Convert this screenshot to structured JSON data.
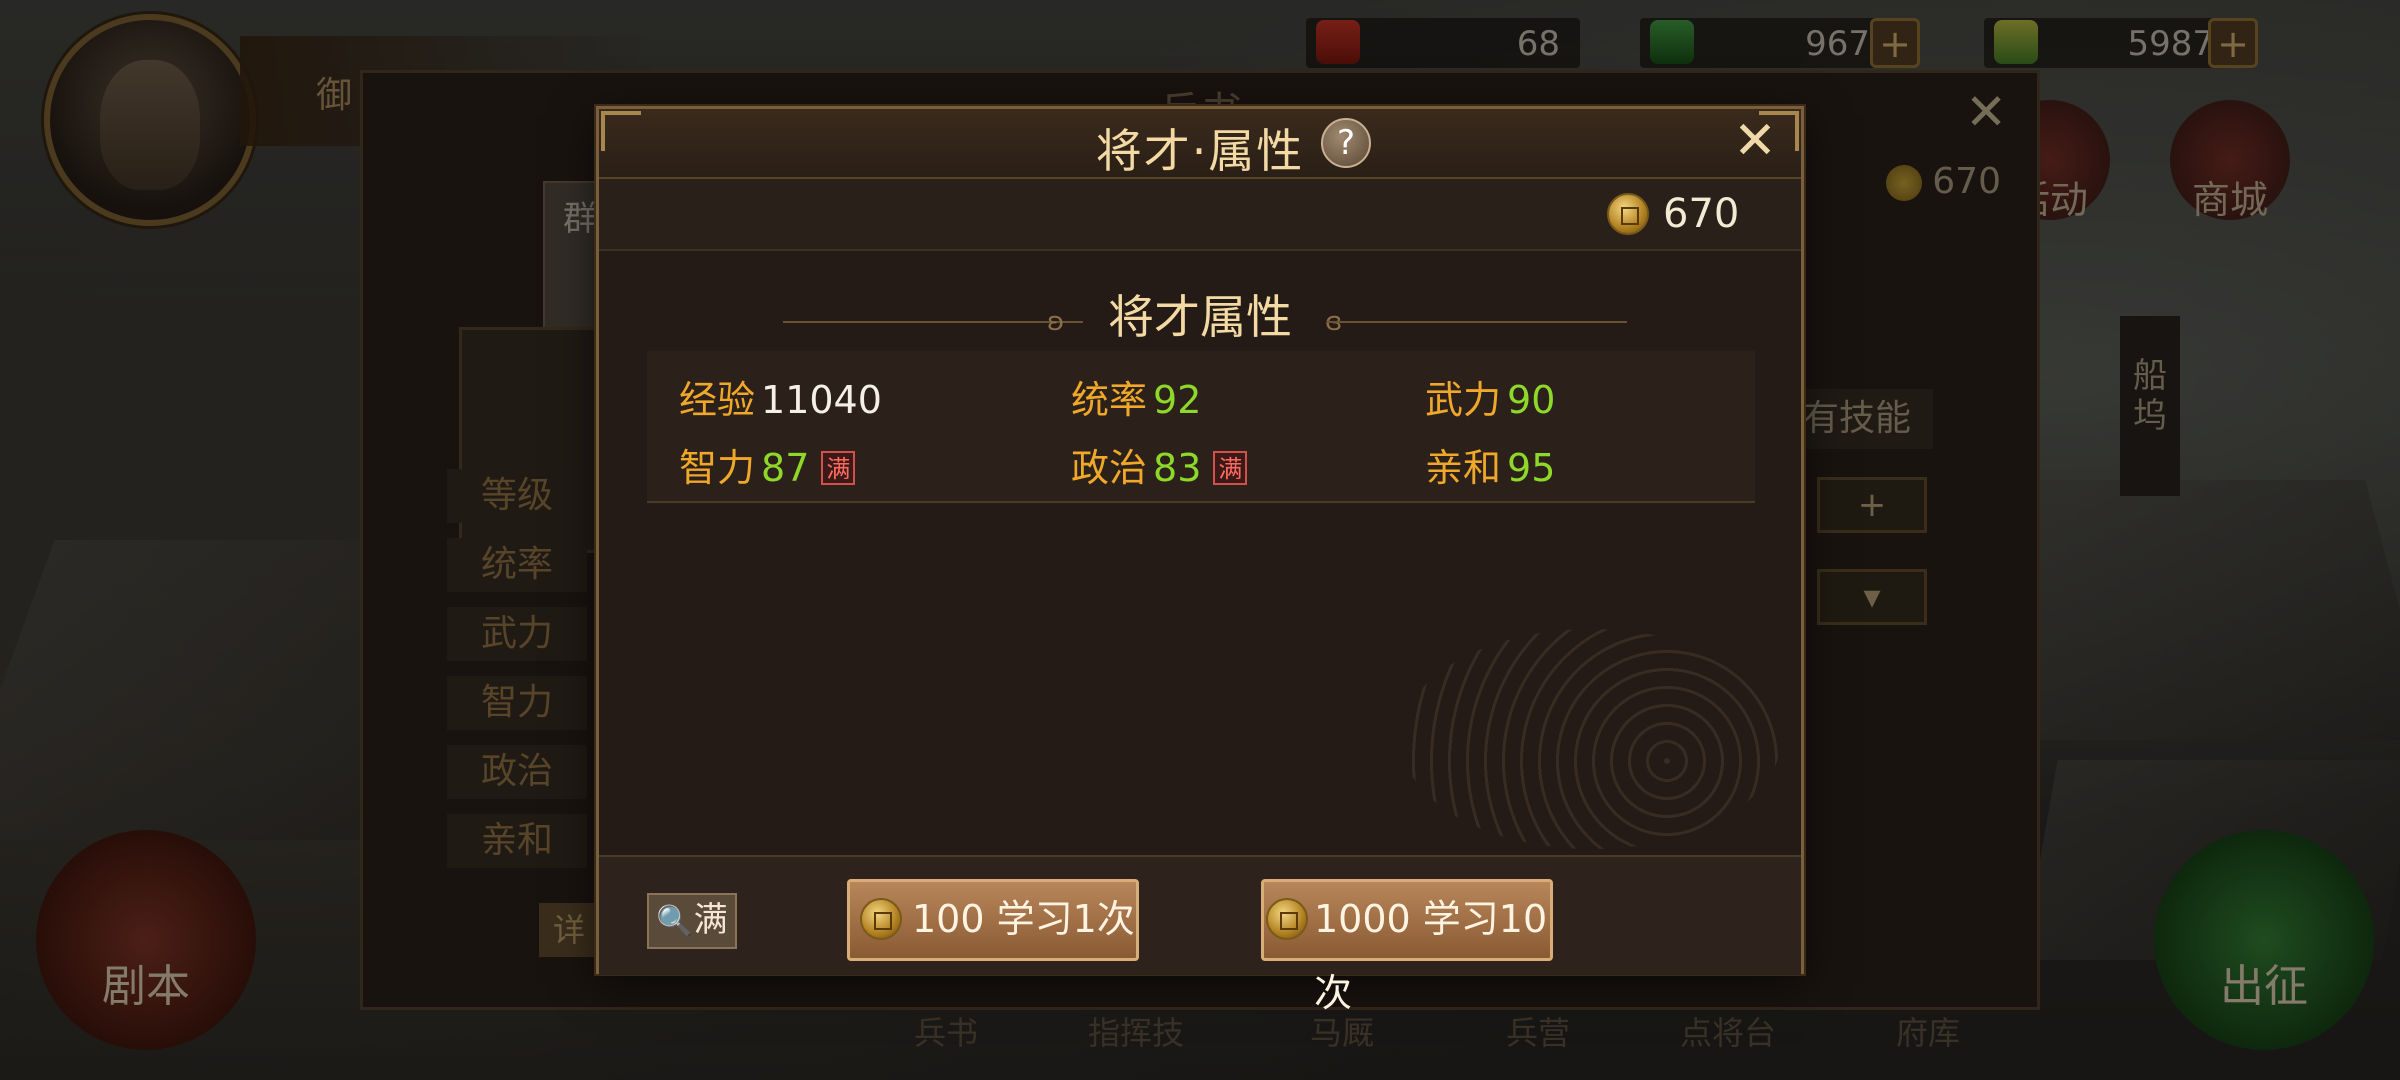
{
  "hud": {
    "player_name": "御",
    "resources": [
      {
        "icon": "red-token-icon",
        "value": "68"
      },
      {
        "icon": "jade-icon",
        "value": "967"
      },
      {
        "icon": "jade-ticket-icon",
        "value": "5987"
      }
    ],
    "top_buttons": [
      {
        "icon": "activity-icon",
        "label": "活动"
      },
      {
        "icon": "shop-icon",
        "label": "商城"
      }
    ],
    "side_tag": "船坞",
    "left_round_button": "剧本",
    "right_round_button": "出征"
  },
  "back_panel": {
    "title": "兵书",
    "faction_flag": "群",
    "coin_value": "670",
    "skill_label": "有技能",
    "attr_labels": [
      "等级",
      "统率",
      "武力",
      "智力",
      "政治",
      "亲和"
    ],
    "detail_label": "详",
    "tabs": [
      "兵书",
      "指挥技",
      "马厩",
      "兵营",
      "点将台",
      "府库"
    ],
    "plus_button": "+"
  },
  "dialog": {
    "title": "将才·属性",
    "help_icon": "?",
    "close_icon": "✕",
    "coin_amount": "670",
    "section_title": "将才属性",
    "stats": {
      "exp": {
        "label": "经验",
        "value": "11040"
      },
      "command": {
        "label": "统率",
        "value": "92"
      },
      "force": {
        "label": "武力",
        "value": "90"
      },
      "intel": {
        "label": "智力",
        "value": "87",
        "badge": "满"
      },
      "politics": {
        "label": "政治",
        "value": "83",
        "badge": "满"
      },
      "charm": {
        "label": "亲和",
        "value": "95"
      }
    },
    "max_button": "满",
    "learn_once": "100 学习1次",
    "learn_ten": "1000 学习10次"
  },
  "colors": {
    "label_orange": "#f0a82a",
    "value_green": "#8ed82a",
    "title_gold": "#f3d9a4",
    "full_badge_red": "#d0504a"
  }
}
